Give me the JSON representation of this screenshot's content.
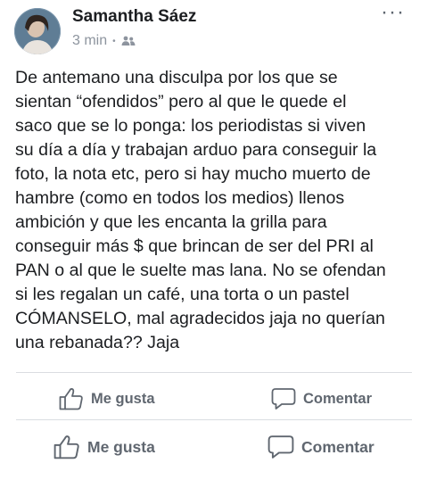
{
  "post": {
    "author": "Samantha Sáez",
    "time": "3 min",
    "separator": "•",
    "audience_icon": "friends-icon",
    "more_icon": "more-options-icon",
    "more_label": "···",
    "text": "De antemano una disculpa por los que se\nsientan “ofendidos” pero al que le quede el\nsaco que se lo ponga: los periodistas si viven\nsu día a día y trabajan arduo para conseguir la\nfoto, la nota etc, pero si hay mucho muerto de\nhambre (como en todos los medios) llenos\nambición y que les encanta la grilla para\nconseguir más $ que brincan de ser del PRI al\nPAN o al que le suelte mas lana. No se ofendan\nsi les regalan un café, una torta o un pastel\nCÓMANSELO, mal agradecidos  jaja no querían\nuna rebanada?? Jaja"
  },
  "actions_row1": {
    "like_label": "Me gusta",
    "like_icon": "thumbs-up-icon",
    "comment_label": "Comentar",
    "comment_icon": "comment-bubble-icon"
  },
  "actions_row2": {
    "like_label": "Me gusta",
    "like_icon": "thumbs-up-icon",
    "comment_label": "Comentar",
    "comment_icon": "comment-bubble-icon"
  }
}
